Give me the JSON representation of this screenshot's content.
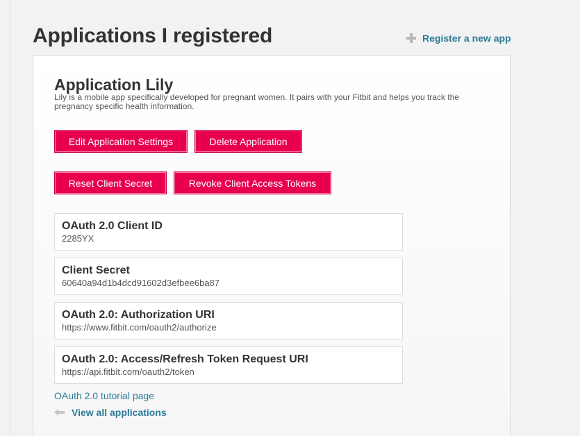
{
  "header": {
    "title": "Applications I registered",
    "register_link": "Register a new app",
    "register_icon": "plus-icon"
  },
  "application": {
    "title": "Application Lily",
    "description": "Lily is a mobile app specifically developed for pregnant women. It pairs with your Fitbit and helps you track the pregnancy specific health information."
  },
  "buttons": {
    "edit": "Edit Application Settings",
    "delete": "Delete Application",
    "reset": "Reset Client Secret",
    "revoke": "Revoke Client Access Tokens"
  },
  "fields": [
    {
      "label": "OAuth 2.0 Client ID",
      "value": "2285YX"
    },
    {
      "label": "Client Secret",
      "value": "60640a94d1b4dcd91602d3efbee6ba87"
    },
    {
      "label": "OAuth 2.0: Authorization URI",
      "value": "https://www.fitbit.com/oauth2/authorize"
    },
    {
      "label": "OAuth 2.0: Access/Refresh Token Request URI",
      "value": "https://api.fitbit.com/oauth2/token"
    }
  ],
  "footer": {
    "tutorial_link": "OAuth 2.0 tutorial page",
    "view_all": "View all applications",
    "view_all_icon": "back-arrow-icon"
  },
  "colors": {
    "accent_button": "#e8004f",
    "link": "#2d7b96",
    "background": "#f2f2f2"
  }
}
